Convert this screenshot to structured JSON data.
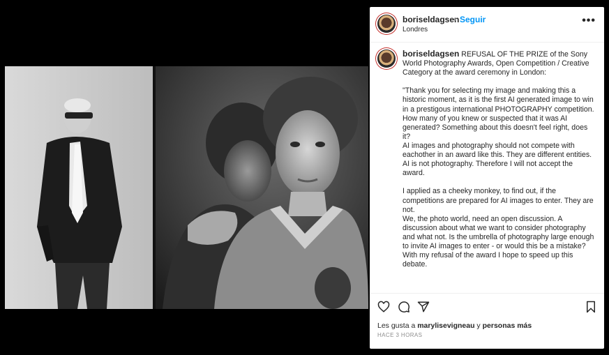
{
  "header": {
    "username": "boriseldagsen",
    "separator": "•",
    "follow_label": "Seguir",
    "location": "Londres",
    "more_label": "•••"
  },
  "caption": {
    "username": "boriseldagsen",
    "first_line": " REFUSAL OF THE PRIZE of the Sony World Photography Awards, Open Competition / Creative Category at the award ceremony in London:",
    "paragraphs": [
      "\"Thank you for selecting my image and making this a historic moment, as it is the first AI generated image to win in a prestigous international PHOTOGRAPHY competition.",
      "How many of you knew or suspected that it was AI generated? Something about this doesn't feel right, does it?",
      "AI images and photography should not compete with eachother in an award like this. They are different entities. AI is not photography. Therefore I will not accept the award.",
      "",
      "I applied as a cheeky monkey, to find out, if the competitions are prepared for AI images to enter. They are not.",
      "We, the photo world, need an open discussion. A discussion about what we want to consider photography and what not. Is the umbrella of photography large enough to invite AI images to enter - or would this be a mistake?",
      "With my refusal of the award I hope to speed up this debate."
    ]
  },
  "actions": {
    "like_icon": "heart-icon",
    "comment_icon": "comment-icon",
    "share_icon": "share-icon",
    "save_icon": "bookmark-icon"
  },
  "likes": {
    "prefix": "Les gusta a ",
    "user": "marylisevigneau",
    "middle": " y ",
    "others": "personas más"
  },
  "timestamp": "HACE 3 HORAS",
  "colors": {
    "accent": "#0095f6",
    "text": "#262626",
    "muted": "#8e8e8e",
    "background": "#000000"
  }
}
